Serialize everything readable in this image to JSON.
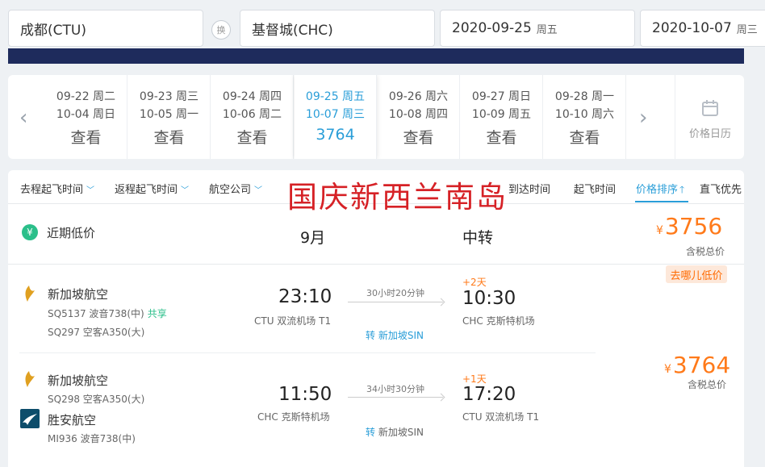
{
  "search": {
    "from": "成都(CTU)",
    "swap": "换",
    "to": "基督城(CHC)",
    "depart_date": "2020-09-25",
    "depart_dow": "周五",
    "return_date": "2020-10-07",
    "return_dow": "周三"
  },
  "date_strip": [
    {
      "out": "09-22 周二",
      "ret": "10-04 周日",
      "price": "查看"
    },
    {
      "out": "09-23 周三",
      "ret": "10-05 周一",
      "price": "查看"
    },
    {
      "out": "09-24 周四",
      "ret": "10-06 周二",
      "price": "查看"
    },
    {
      "out": "09-25 周五",
      "ret": "10-07 周三",
      "price": "3764"
    },
    {
      "out": "09-26 周六",
      "ret": "10-08 周四",
      "price": "查看"
    },
    {
      "out": "09-27 周日",
      "ret": "10-09 周五",
      "price": "查看"
    },
    {
      "out": "09-28 周一",
      "ret": "10-10 周六",
      "price": "查看"
    }
  ],
  "calendar_label": "价格日历",
  "filters": {
    "outbound_time": "去程起飞时间",
    "return_time": "返程起飞时间",
    "airline": "航空公司",
    "arrive_time": "到达时间",
    "takeoff": "起飞时间",
    "price_sort": "价格排序",
    "direct": "直飞优先"
  },
  "overlay_text": "国庆新西兰南岛",
  "low_price": {
    "badge": "¥",
    "label": "近期低价",
    "month": "9月",
    "type": "中转",
    "currency": "¥",
    "price": "3756",
    "note": "含税总价"
  },
  "qunar_tag": "去哪儿低价",
  "result": {
    "currency": "¥",
    "price": "3764",
    "note": "含税总价",
    "outbound": {
      "airline": "新加坡航空",
      "flight1": "SQ5137 波音738(中)",
      "share": "共享",
      "flight2": "SQ297 空客A350(大)",
      "dep_time": "23:10",
      "dep_airport": "CTU 双流机场 T1",
      "duration": "30小时20分钟",
      "transfer": "转",
      "transfer_city": "新加坡SIN",
      "plus_days": "+2天",
      "arr_time": "10:30",
      "arr_airport": "CHC 克斯特机场"
    },
    "inbound": {
      "airline1": "新加坡航空",
      "flight1": "SQ298 空客A350(大)",
      "airline2": "胜安航空",
      "flight2": "MI936 波音738(中)",
      "dep_time": "11:50",
      "dep_airport": "CHC 克斯特机场",
      "duration": "34小时30分钟",
      "transfer": "转",
      "transfer_city": "新加坡SIN",
      "plus_days": "+1天",
      "arr_time": "17:20",
      "arr_airport": "CTU 双流机场 T1"
    }
  }
}
